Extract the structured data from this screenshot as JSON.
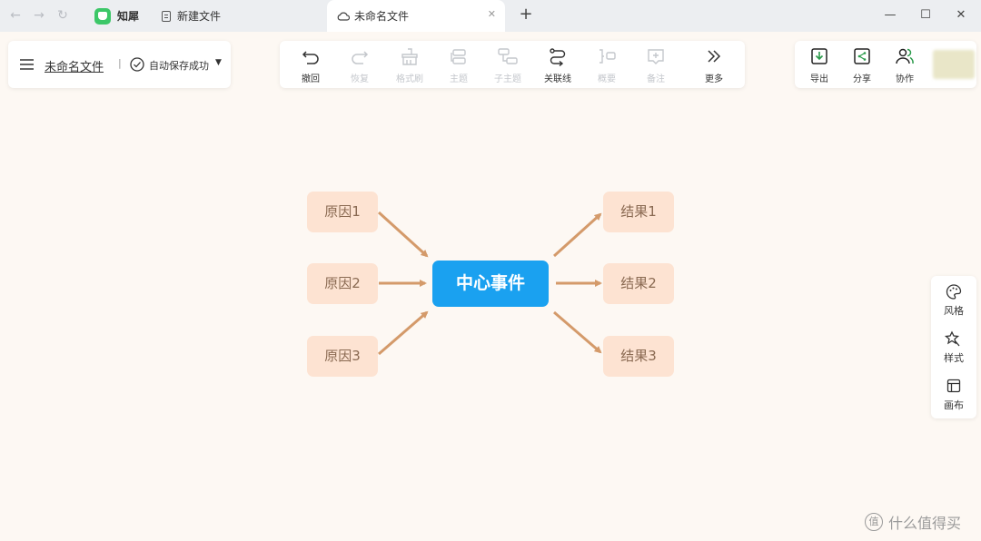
{
  "titlebar": {
    "back_icon": "arrow-left-icon",
    "forward_icon": "arrow-right-icon",
    "reload_icon": "reload-icon",
    "tabs": [
      {
        "label": "知犀",
        "icon": "app-logo-icon"
      },
      {
        "label": "新建文件",
        "icon": "document-icon"
      },
      {
        "label": "未命名文件",
        "icon": "cloud-icon",
        "close": "✕"
      }
    ],
    "new_tab": "+",
    "window_controls": [
      "minimize",
      "maximize",
      "close"
    ]
  },
  "filebar": {
    "menu_icon": "hamburger-menu-icon",
    "file_name": "未命名文件",
    "separator": "|",
    "save_status": "自动保存成功",
    "save_status_icon": "check-circle-icon",
    "dropdown_icon": "caret-down-icon"
  },
  "toolbar": {
    "items": [
      {
        "label": "撤回",
        "icon": "undo-icon",
        "enabled": true
      },
      {
        "label": "恢复",
        "icon": "redo-icon",
        "enabled": false
      },
      {
        "label": "格式刷",
        "icon": "format-brush-icon",
        "enabled": false
      },
      {
        "label": "主题",
        "icon": "topic-icon",
        "enabled": false
      },
      {
        "label": "子主题",
        "icon": "subtopic-icon",
        "enabled": false
      },
      {
        "label": "关联线",
        "icon": "relation-line-icon",
        "enabled": true
      },
      {
        "label": "概要",
        "icon": "summary-icon",
        "enabled": false
      },
      {
        "label": "备注",
        "icon": "note-icon",
        "enabled": false
      },
      {
        "label": "更多",
        "icon": "double-chevron-right-icon",
        "enabled": true
      }
    ]
  },
  "actions": {
    "items": [
      {
        "label": "导出",
        "icon": "export-icon"
      },
      {
        "label": "分享",
        "icon": "share-icon"
      },
      {
        "label": "协作",
        "icon": "collaborate-icon"
      }
    ],
    "accent": "#2a9a4a"
  },
  "right_panel": {
    "items": [
      {
        "label": "风格",
        "icon": "palette-icon"
      },
      {
        "label": "样式",
        "icon": "magic-wand-icon"
      },
      {
        "label": "画布",
        "icon": "canvas-layout-icon"
      }
    ]
  },
  "mindmap": {
    "center": "中心事件",
    "causes": [
      "原因1",
      "原因2",
      "原因3"
    ],
    "results": [
      "结果1",
      "结果2",
      "结果3"
    ],
    "center_color": "#1aa1f0",
    "node_color": "#fde3d2",
    "link_color": "#d49a6a"
  },
  "watermark": "什么值得买",
  "watermark_logo": "值"
}
